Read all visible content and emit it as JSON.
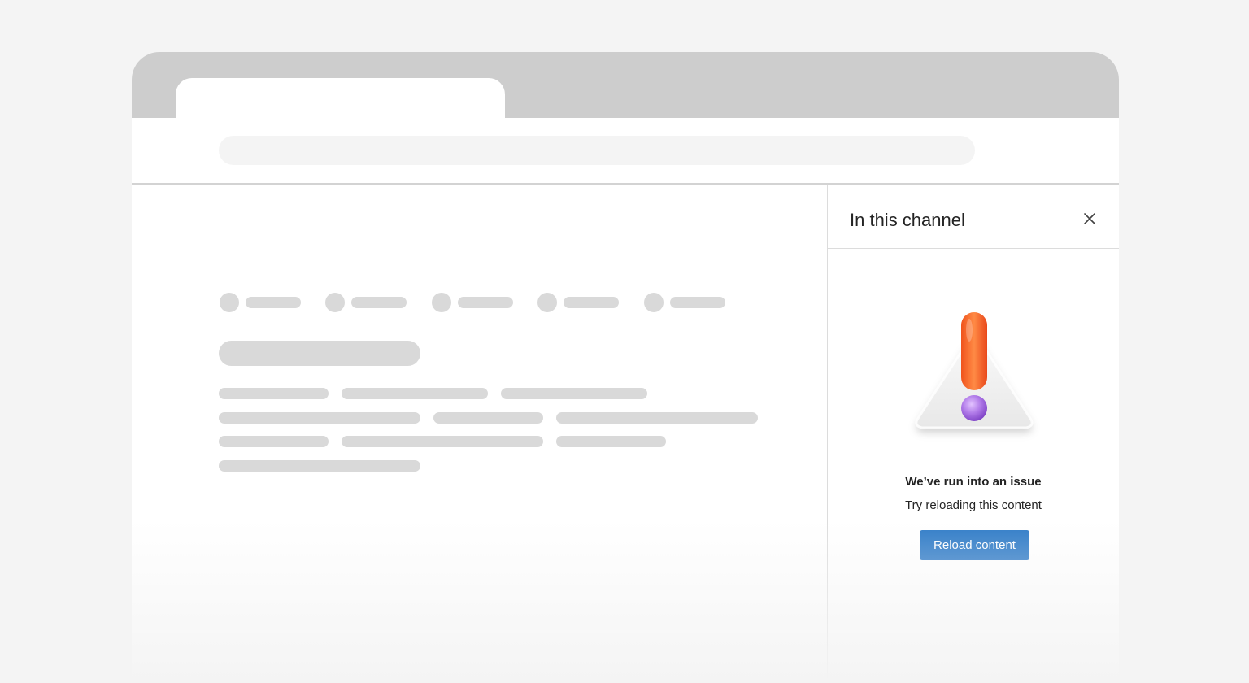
{
  "panel": {
    "title": "In this channel",
    "close_icon": "close-icon",
    "illustration_icon": "warning-icon",
    "error_title": "We’ve run into an issue",
    "error_subtitle": "Try reloading this content",
    "reload_label": "Reload content"
  },
  "colors": {
    "accent": "#2f7bc7",
    "background": "#f4f4f4",
    "tabstrip": "#cdcdcd",
    "skeleton": "#d9d9d9",
    "exclamation_bar": "#ff6a2a",
    "exclamation_dot": "#a86ae0"
  }
}
